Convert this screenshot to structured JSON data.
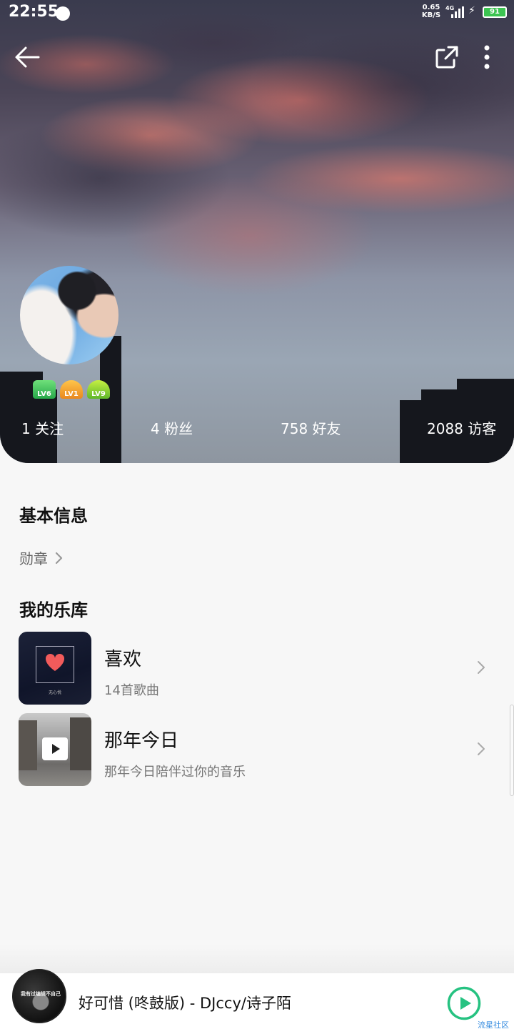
{
  "status_bar": {
    "time": "22:55",
    "net_speed_value": "0.65",
    "net_speed_unit": "KB/S",
    "network_type": "4G",
    "battery": "91"
  },
  "header": {
    "back_icon": "arrow-left-icon",
    "share_icon": "share-external-icon",
    "more_icon": "more-vertical-icon"
  },
  "profile": {
    "badges": [
      {
        "label": "LV6",
        "color": "#27a84a"
      },
      {
        "label": "LV1",
        "color": "#e9881f"
      },
      {
        "label": "LV9",
        "color": "#5fb72a"
      }
    ],
    "stats": {
      "following": "1 关注",
      "fans": "4 粉丝",
      "friends": "758 好友",
      "visitors": "2088 访客"
    }
  },
  "basic_info": {
    "title": "基本信息",
    "medal_label": "勋章"
  },
  "library": {
    "title": "我的乐库",
    "items": [
      {
        "name": "喜欢",
        "subtitle": "14首歌曲",
        "cover_caption": "无心悦"
      },
      {
        "name": "那年今日",
        "subtitle": "那年今日陪伴过你的音乐"
      }
    ]
  },
  "player": {
    "disc_text": "我有过编辑不自己",
    "song": "好可惜 (咚鼓版) - DJccy/诗子陌",
    "accent": "#26c281"
  },
  "watermark": "流星社区"
}
